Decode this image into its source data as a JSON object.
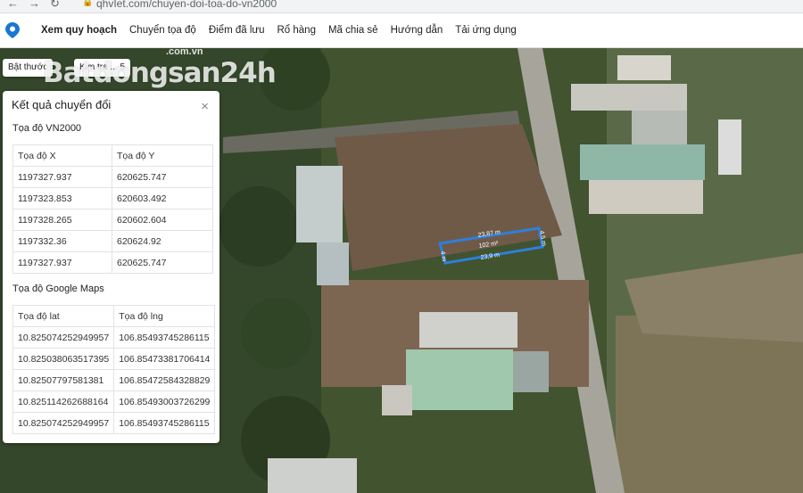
{
  "browser": {
    "url": "qhvIet.com/chuyen-doi-toa-do-vn2000"
  },
  "menu": [
    "Xem quy hoạch",
    "Chuyển tọa độ",
    "Điểm đã lưu",
    "Rổ hàng",
    "Mã chia sẻ",
    "Hướng dẫn",
    "Tải ứng dụng"
  ],
  "map_controls": {
    "toggle_label": "Bật thước",
    "secondary_label": "Kim tra ... 5"
  },
  "watermark": {
    "text": "Batdongsan24h",
    "sub": ".com.vn"
  },
  "plot": {
    "top_dim": "23,87 m",
    "bottom_dim": "23,9 m",
    "left_dim": "4 m",
    "right_dim": "4,5 m",
    "area": "102 m²"
  },
  "panel": {
    "title": "Kết quả chuyển đổi",
    "close_symbol": "×",
    "vn2000_title": "Tọa độ VN2000",
    "vn2000_headers": [
      "Tọa độ X",
      "Tọa độ Y"
    ],
    "vn2000_rows": [
      [
        "1197327.937",
        "620625.747"
      ],
      [
        "1197323.853",
        "620603.492"
      ],
      [
        "1197328.265",
        "620602.604"
      ],
      [
        "1197332.36",
        "620624.92"
      ],
      [
        "1197327.937",
        "620625.747"
      ]
    ],
    "gmaps_title": "Tọa độ Google Maps",
    "gmaps_headers": [
      "Tọa độ lat",
      "Tọa độ lng"
    ],
    "gmaps_rows": [
      [
        "10.825074252949957",
        "106.85493745286115"
      ],
      [
        "10.825038063517395",
        "106.85473381706414"
      ],
      [
        "10.82507797581381",
        "106.85472584328829"
      ],
      [
        "10.825114262688164",
        "106.85493003726299"
      ],
      [
        "10.825074252949957",
        "106.85493745286115"
      ]
    ]
  },
  "colors": {
    "plot_outline": "#2f7fd8",
    "map_vegetation": "#3f5233",
    "soil": "#7a6450"
  }
}
